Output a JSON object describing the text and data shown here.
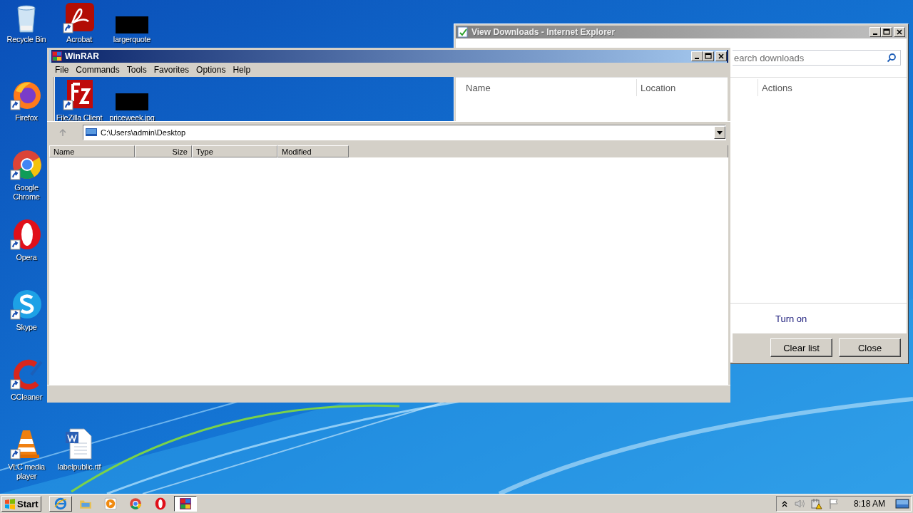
{
  "desktop": {
    "icons": [
      {
        "label": "Recycle Bin",
        "kind": "recycle",
        "shortcut": false
      },
      {
        "label": "Acrobat",
        "kind": "acrobat",
        "shortcut": true
      },
      {
        "label": "largerquote",
        "kind": "thumbnail",
        "shortcut": false
      },
      {
        "label": "Firefox",
        "kind": "firefox",
        "shortcut": true
      },
      {
        "label": "FileZilla Client",
        "kind": "filezilla",
        "shortcut": true
      },
      {
        "label": "priceweek.jpg",
        "kind": "thumbnail",
        "shortcut": false
      },
      {
        "label": "Google Chrome",
        "kind": "chrome",
        "shortcut": true
      },
      {
        "label": "Opera",
        "kind": "opera",
        "shortcut": true
      },
      {
        "label": "Skype",
        "kind": "skype",
        "shortcut": true
      },
      {
        "label": "CCleaner",
        "kind": "ccleaner",
        "shortcut": true
      },
      {
        "label": "VLC media player",
        "kind": "vlc",
        "shortcut": true
      },
      {
        "label": "labelpublic.rtf",
        "kind": "document",
        "shortcut": false
      }
    ]
  },
  "downloads_window": {
    "title": "View Downloads - Internet Explorer",
    "search": {
      "placeholder": "earch downloads"
    },
    "columns": [
      "Name",
      "Location",
      "Actions"
    ],
    "link": "Turn on",
    "buttons": [
      "Clear list",
      "Close"
    ]
  },
  "winrar": {
    "title": "WinRAR",
    "menu": [
      "File",
      "Commands",
      "Tools",
      "Favorites",
      "Options",
      "Help"
    ],
    "address": "C:\\Users\\admin\\Desktop",
    "columns": [
      "Name",
      "Size",
      "Type",
      "Modified"
    ]
  },
  "taskbar": {
    "start": "Start",
    "items": [
      {
        "kind": "ie",
        "open": true,
        "selected": false
      },
      {
        "kind": "folder",
        "open": false,
        "selected": false
      },
      {
        "kind": "media",
        "open": false,
        "selected": false
      },
      {
        "kind": "chrome",
        "open": false,
        "selected": false
      },
      {
        "kind": "opera",
        "open": false,
        "selected": false
      },
      {
        "kind": "winrar",
        "open": true,
        "selected": true
      }
    ],
    "clock": "8:18 AM"
  }
}
